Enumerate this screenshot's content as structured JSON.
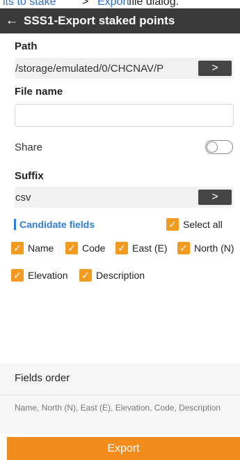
{
  "caption": {
    "link_a": "its to stake",
    "separator": " > ",
    "link_b": "Export",
    "suffix_text": " file dialog."
  },
  "header": {
    "title": "SSS1-Export staked points"
  },
  "path": {
    "label": "Path",
    "value": "/storage/emulated/0/CHCNAV/P",
    "button": ">"
  },
  "file_name": {
    "label": "File name",
    "value": ""
  },
  "share": {
    "label": "Share",
    "enabled": false
  },
  "suffix": {
    "label": "Suffix",
    "value": "csv",
    "button": ">"
  },
  "candidate_fields": {
    "label": "Candidate fields",
    "select_all": {
      "label": "Select all",
      "checked": true
    },
    "items": [
      {
        "label": "Name",
        "checked": true
      },
      {
        "label": "Code",
        "checked": true
      },
      {
        "label": "East (E)",
        "checked": true
      },
      {
        "label": "North (N)",
        "checked": true
      },
      {
        "label": "Elevation",
        "checked": true
      },
      {
        "label": "Description",
        "checked": true
      }
    ],
    "check_glyph": "✓"
  },
  "fields_order": {
    "label": "Fields order",
    "value": "Name, North (N), East (E), Elevation, Code, Description"
  },
  "export_button": {
    "label": "Export"
  },
  "colors": {
    "accent": "#f28c1c",
    "checkbox": "#f39a21",
    "link_blue": "#2f7fd8",
    "header_bg": "#3a3a3a"
  },
  "icons": {
    "back": "arrow-left-icon",
    "next": "chevron-right-icon",
    "check": "checkmark-icon"
  }
}
